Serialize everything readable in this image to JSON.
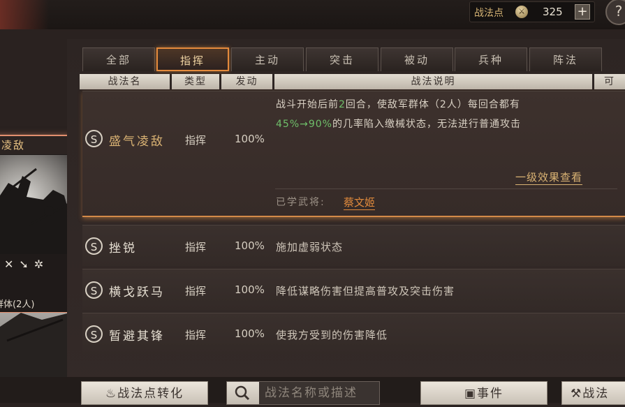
{
  "topbar": {
    "points_label": "战法点",
    "points_value": "325",
    "plus_symbol": "+",
    "help_symbol": "?"
  },
  "tabs": [
    {
      "label": "全部"
    },
    {
      "label": "指挥"
    },
    {
      "label": "主动"
    },
    {
      "label": "突击"
    },
    {
      "label": "被动"
    },
    {
      "label": "兵种"
    },
    {
      "label": "阵法"
    }
  ],
  "active_tab": "指挥",
  "columns": {
    "name": "战法名",
    "type": "类型",
    "trigger": "发动",
    "description": "战法说明",
    "extra": "可"
  },
  "rows": [
    {
      "badge": "S",
      "name": "盛气凌敌",
      "type": "指挥",
      "rate": "100%",
      "desc_line1_a": "战斗开始后前",
      "desc_line1_b": "2",
      "desc_line1_c": "回合，使敌军群体（2人）每回合都有",
      "desc_line2_a": "45%→90%",
      "desc_line2_b": "的几率陷入缴械状态，无法进行普通攻击",
      "effect_link": "一级效果查看",
      "learned_label": "已学武将:",
      "learned_name": "蔡文姬"
    },
    {
      "badge": "S",
      "name": "挫锐",
      "type": "指挥",
      "rate": "100%",
      "desc": "施加虚弱状态"
    },
    {
      "badge": "S",
      "name": "横戈跃马",
      "type": "指挥",
      "rate": "100%",
      "desc": "降低谋略伤害但提高普攻及突击伤害"
    },
    {
      "badge": "S",
      "name": "暂避其锋",
      "type": "指挥",
      "rate": "100%",
      "desc": "使我方受到的伤害降低"
    }
  ],
  "card": {
    "title": "凌敌",
    "icons": [
      "crossed-swords-icon",
      "arrow-icon",
      "wheel-icon"
    ],
    "target": "群体(2人)"
  },
  "bottom": {
    "convert_label": "战法点转化",
    "search_placeholder": "战法名称或描述",
    "event_label": "事件",
    "tactic_label": "战法"
  },
  "colors": {
    "accent_orange": "#e48a3c",
    "highlight_green": "#6fbf6a",
    "name_gold": "#d9b273"
  }
}
